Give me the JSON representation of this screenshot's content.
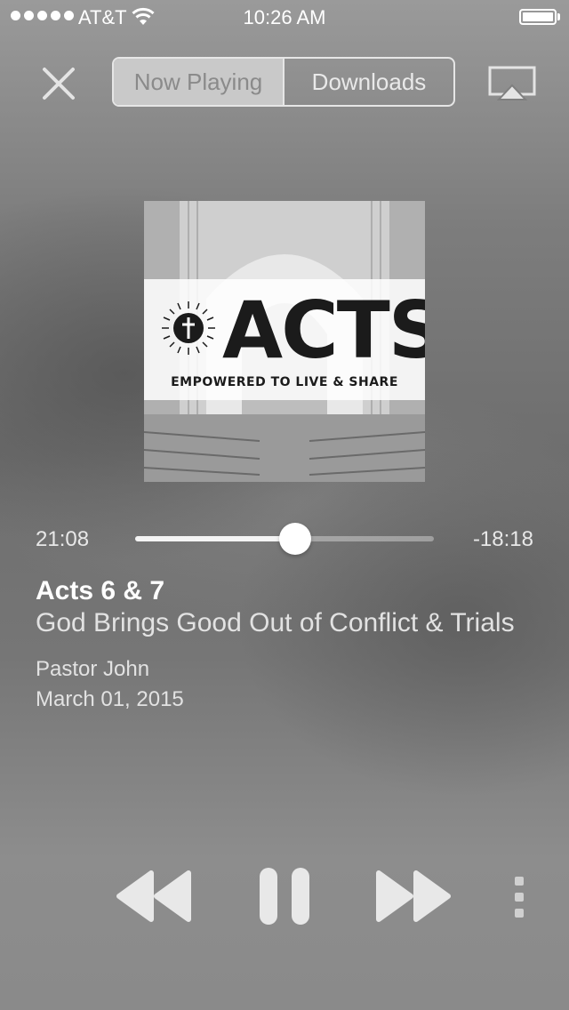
{
  "status_bar": {
    "carrier": "AT&T",
    "time": "10:26 AM",
    "signal_bars": 5
  },
  "top_bar": {
    "close_icon": "close-icon",
    "tabs": [
      {
        "label": "Now Playing",
        "active": true
      },
      {
        "label": "Downloads",
        "active": false
      }
    ],
    "airplay_icon": "airplay-icon"
  },
  "artwork": {
    "title": "ACTS",
    "subtitle": "EMPOWERED TO LIVE & SHARE",
    "seal_icon": "cross-seal-icon"
  },
  "progress": {
    "elapsed": "21:08",
    "remaining": "-18:18",
    "fraction": 0.535
  },
  "track": {
    "title": "Acts 6 & 7",
    "subtitle": "God Brings Good Out of Conflict & Trials",
    "speaker": "Pastor John",
    "date": "March 01, 2015"
  },
  "controls": {
    "rewind_icon": "rewind-icon",
    "pause_icon": "pause-icon",
    "fast_forward_icon": "fast-forward-icon",
    "more_icon": "more-vertical-icon"
  },
  "colors": {
    "accent": "#ffffff",
    "segment_active_bg": "#c9c9c9"
  }
}
